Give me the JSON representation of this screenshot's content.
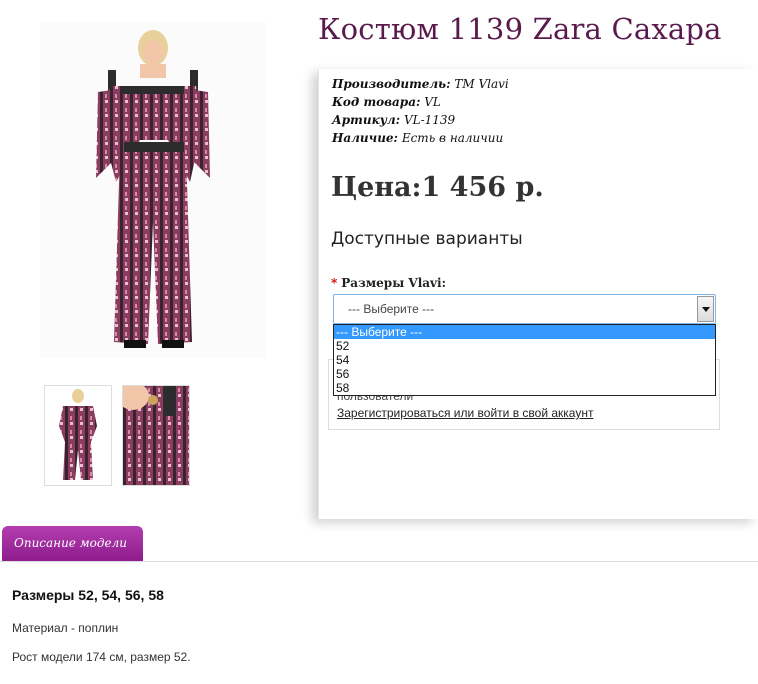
{
  "product": {
    "title": "Костюм 1139 Zara Сахара",
    "manufacturer_label": "Производитель:",
    "manufacturer_value": "ТМ Vlavi",
    "code_label": "Код товара:",
    "code_value": "VL",
    "sku_label": "Артикул:",
    "sku_value": "VL-1139",
    "availability_label": "Наличие:",
    "availability_value": "Есть в наличии",
    "price": "Цена:1 456 р."
  },
  "options": {
    "heading": "Доступные варианты",
    "size_label": "Размеры Vlavi:",
    "required_mark": "*",
    "select_value": "--- Выберите ---",
    "list": [
      "--- Выберите ---",
      "52",
      "54",
      "56",
      "58"
    ]
  },
  "login": {
    "note": "пользователи",
    "link": "Зарегистрироваться или войти в свой аккаунт"
  },
  "tabs": {
    "description": "Описание модели"
  },
  "description": {
    "sizes": "Размеры 52, 54, 56, 58",
    "material": "Материал - поплин",
    "model_height": "Рост модели 174 см, размер 52."
  },
  "colors": {
    "title": "#5a1a4c",
    "tab": "#a22ea0",
    "select_highlight": "#3399ff",
    "fabric_main": "#8a3d5f"
  },
  "icons": {
    "select_arrow": "chevron-down-icon"
  }
}
